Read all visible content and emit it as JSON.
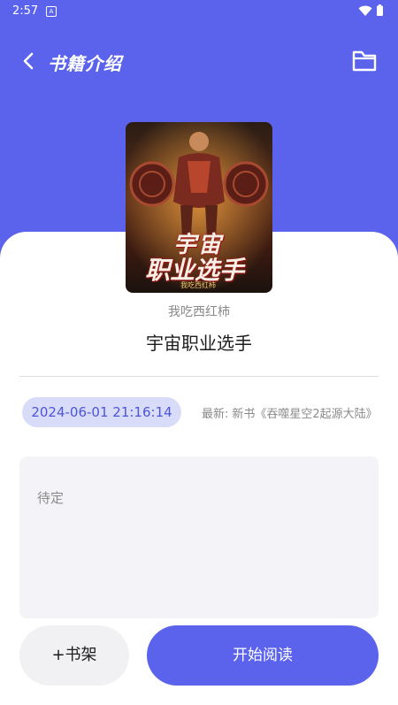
{
  "status_bar": {
    "time": "2:57",
    "app_icon": "A"
  },
  "header": {
    "title": "书籍介绍",
    "back_icon": "chevron-left-icon",
    "action_icon": "folder-icon"
  },
  "book": {
    "cover_text": {
      "line1": "宇宙",
      "line2": "职业选手",
      "author_mark": "我吃西红柿"
    },
    "author": "我吃西红柿",
    "title": "宇宙职业选手",
    "updated": "2024-06-01 21:16:14",
    "latest_label": "最新:",
    "latest_chapter": "新书《吞噬星空2起源大陆》",
    "description": "待定"
  },
  "actions": {
    "add_shelf": "+书架",
    "start_reading": "开始阅读"
  },
  "colors": {
    "accent": "#5b63ec",
    "badge_bg": "#d9dcf9",
    "badge_text": "#4d55d6"
  }
}
